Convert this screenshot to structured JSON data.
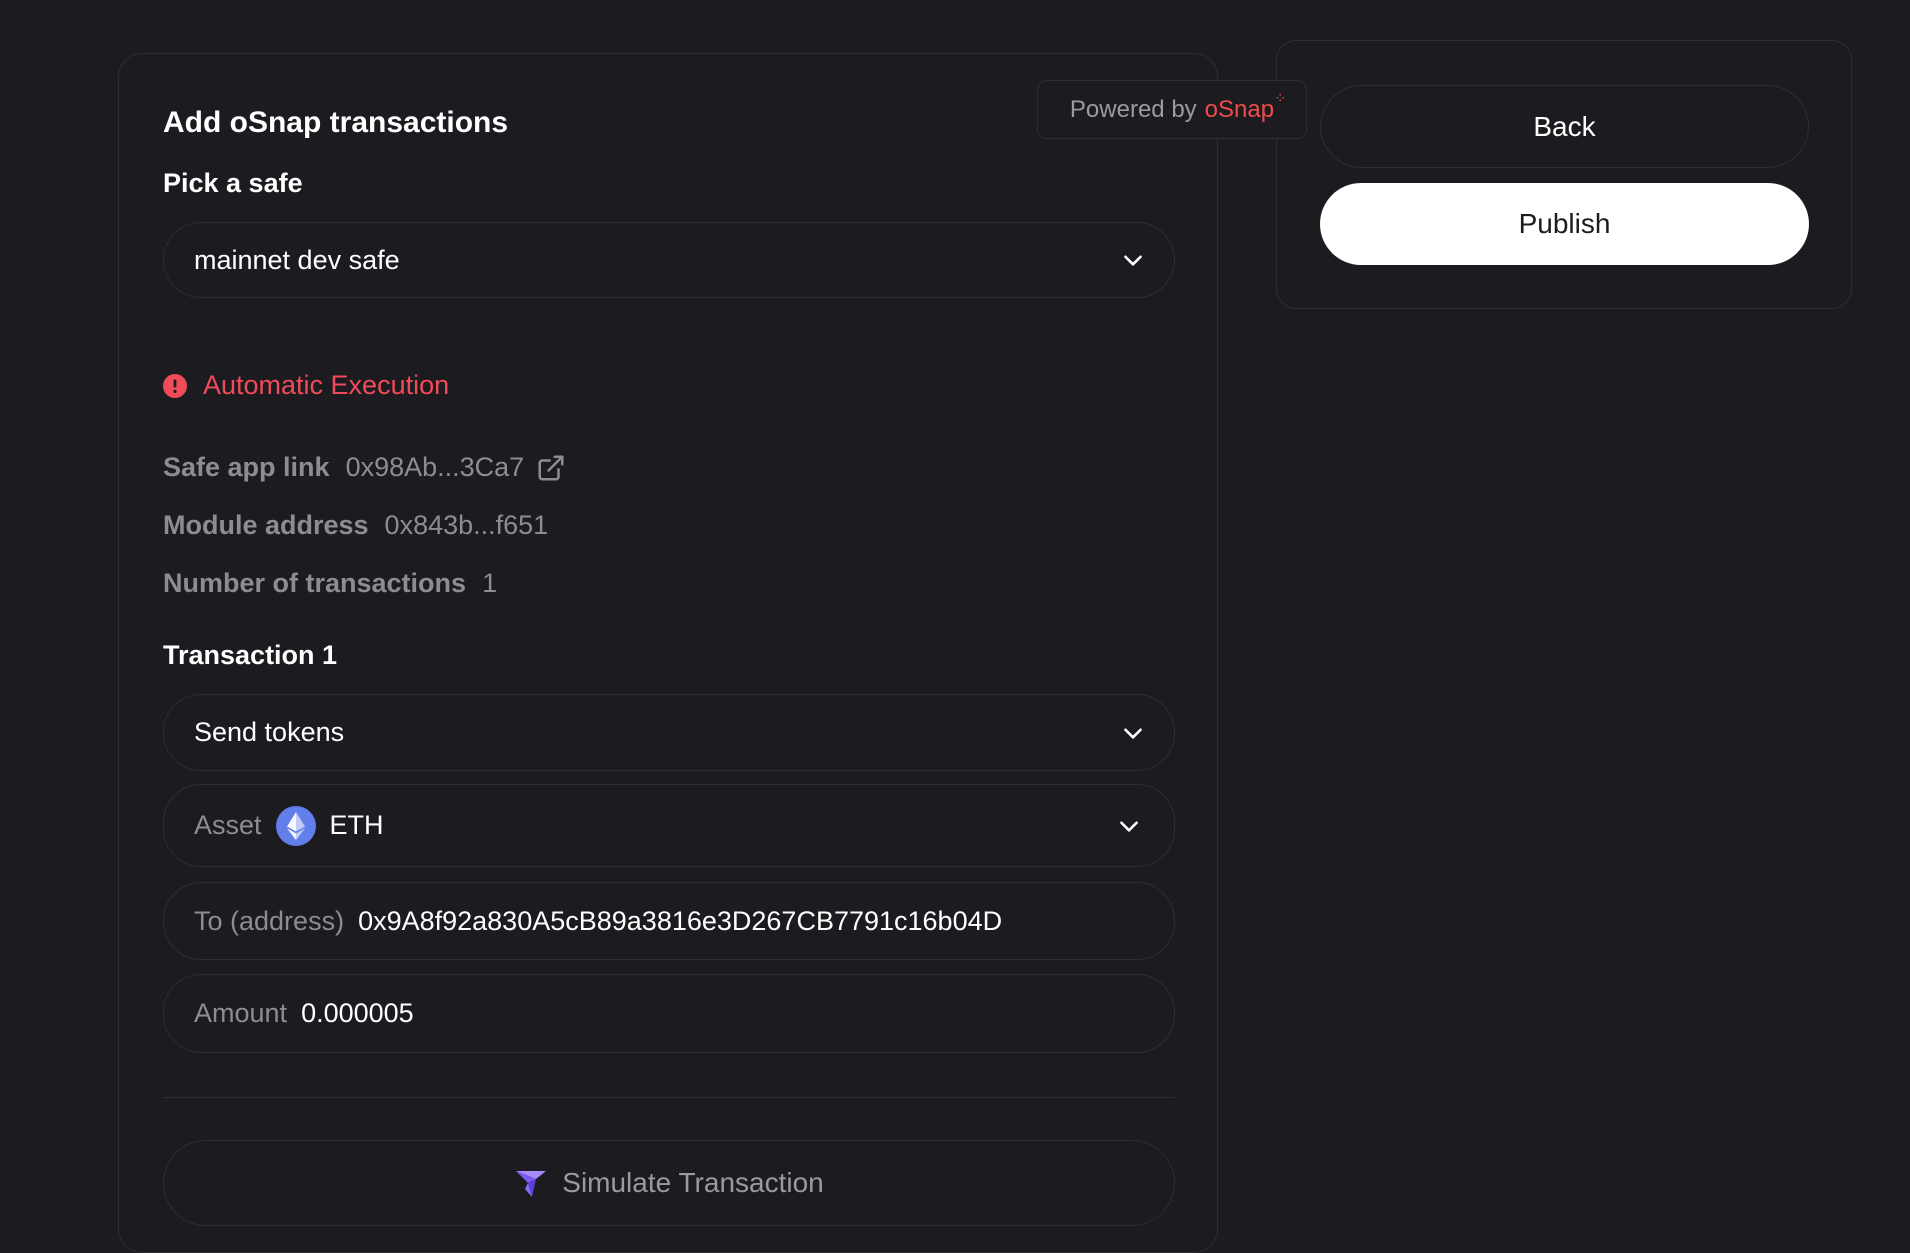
{
  "powered_by": {
    "prefix": "Powered by",
    "brand": "oSnap",
    "brand_color": "#ef4b4b"
  },
  "form": {
    "title": "Add oSnap transactions",
    "pick_safe_label": "Pick a safe",
    "safe_select": {
      "value": "mainnet dev safe",
      "icon": "chevron-down-icon"
    },
    "warning": {
      "text": "Automatic Execution",
      "icon": "alert-circle-icon",
      "color": "#ef4b5a"
    },
    "info": {
      "safe_app_link": {
        "label": "Safe app link",
        "value": "0x98Ab...3Ca7",
        "icon": "external-link-icon"
      },
      "module_address": {
        "label": "Module address",
        "value": "0x843b...f651"
      },
      "num_transactions": {
        "label": "Number of transactions",
        "value": "1"
      }
    },
    "transaction": {
      "title": "Transaction 1",
      "type_select": {
        "value": "Send tokens",
        "icon": "chevron-down-icon"
      },
      "asset": {
        "label": "Asset",
        "value": "ETH",
        "icon": "ethereum-icon"
      },
      "to_address": {
        "label": "To (address)",
        "value": "0x9A8f92a830A5cB89a3816e3D267CB7791c16b04D"
      },
      "amount": {
        "label": "Amount",
        "value": "0.000005"
      }
    },
    "simulate_button": {
      "label": "Simulate Transaction",
      "icon": "tenderly-icon"
    }
  },
  "actions": {
    "back_label": "Back",
    "publish_label": "Publish"
  },
  "colors": {
    "background": "#1c1b20",
    "border": "#2e2d33",
    "muted_text": "#8d8c94",
    "eth_icon": "#627eea"
  }
}
